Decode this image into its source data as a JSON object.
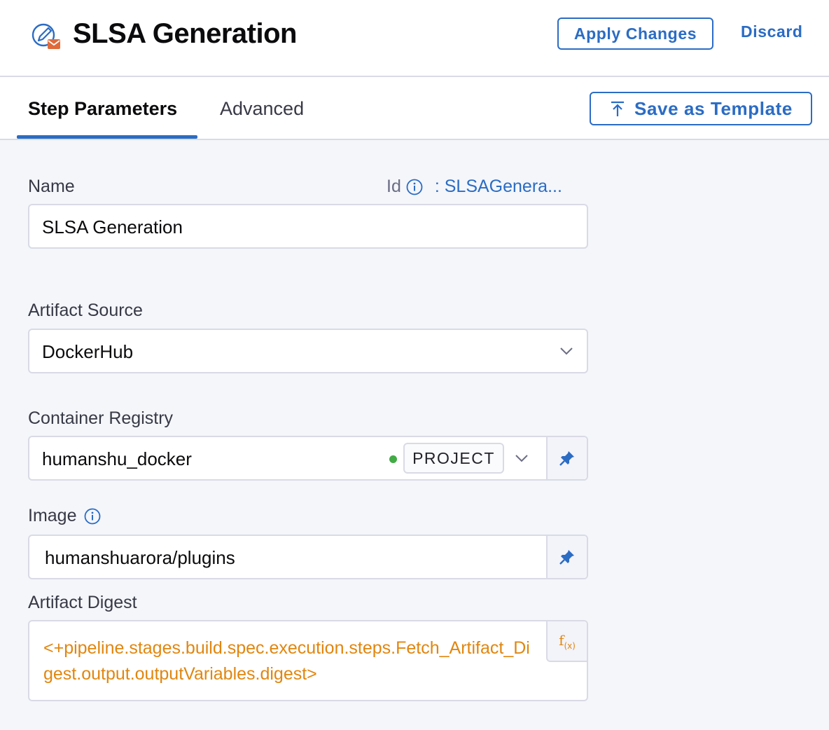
{
  "header": {
    "title": "SLSA Generation",
    "apply_label": "Apply Changes",
    "discard_label": "Discard",
    "accent_color": "#2b6cc4",
    "icon_accent_color": "#e06a3a"
  },
  "tabs": [
    {
      "label": "Step Parameters",
      "active": true
    },
    {
      "label": "Advanced",
      "active": false
    }
  ],
  "template_button": {
    "label": "Save as Template"
  },
  "form": {
    "name": {
      "label": "Name",
      "value": "SLSA Generation"
    },
    "id": {
      "label": "Id",
      "value": ": SLSAGenera..."
    },
    "artifact_source": {
      "label": "Artifact Source",
      "value": "DockerHub"
    },
    "container_registry": {
      "label": "Container Registry",
      "value": "humanshu_docker",
      "scope_badge": "PROJECT",
      "status_color": "#42ab45"
    },
    "image": {
      "label": "Image",
      "value": "humanshuarora/plugins"
    },
    "artifact_digest": {
      "label": "Artifact Digest",
      "value": "<+pipeline.stages.build.spec.execution.steps.Fetch_Artifact_Digest.output.outputVariables.digest>",
      "expression_color": "#e1860f"
    }
  }
}
